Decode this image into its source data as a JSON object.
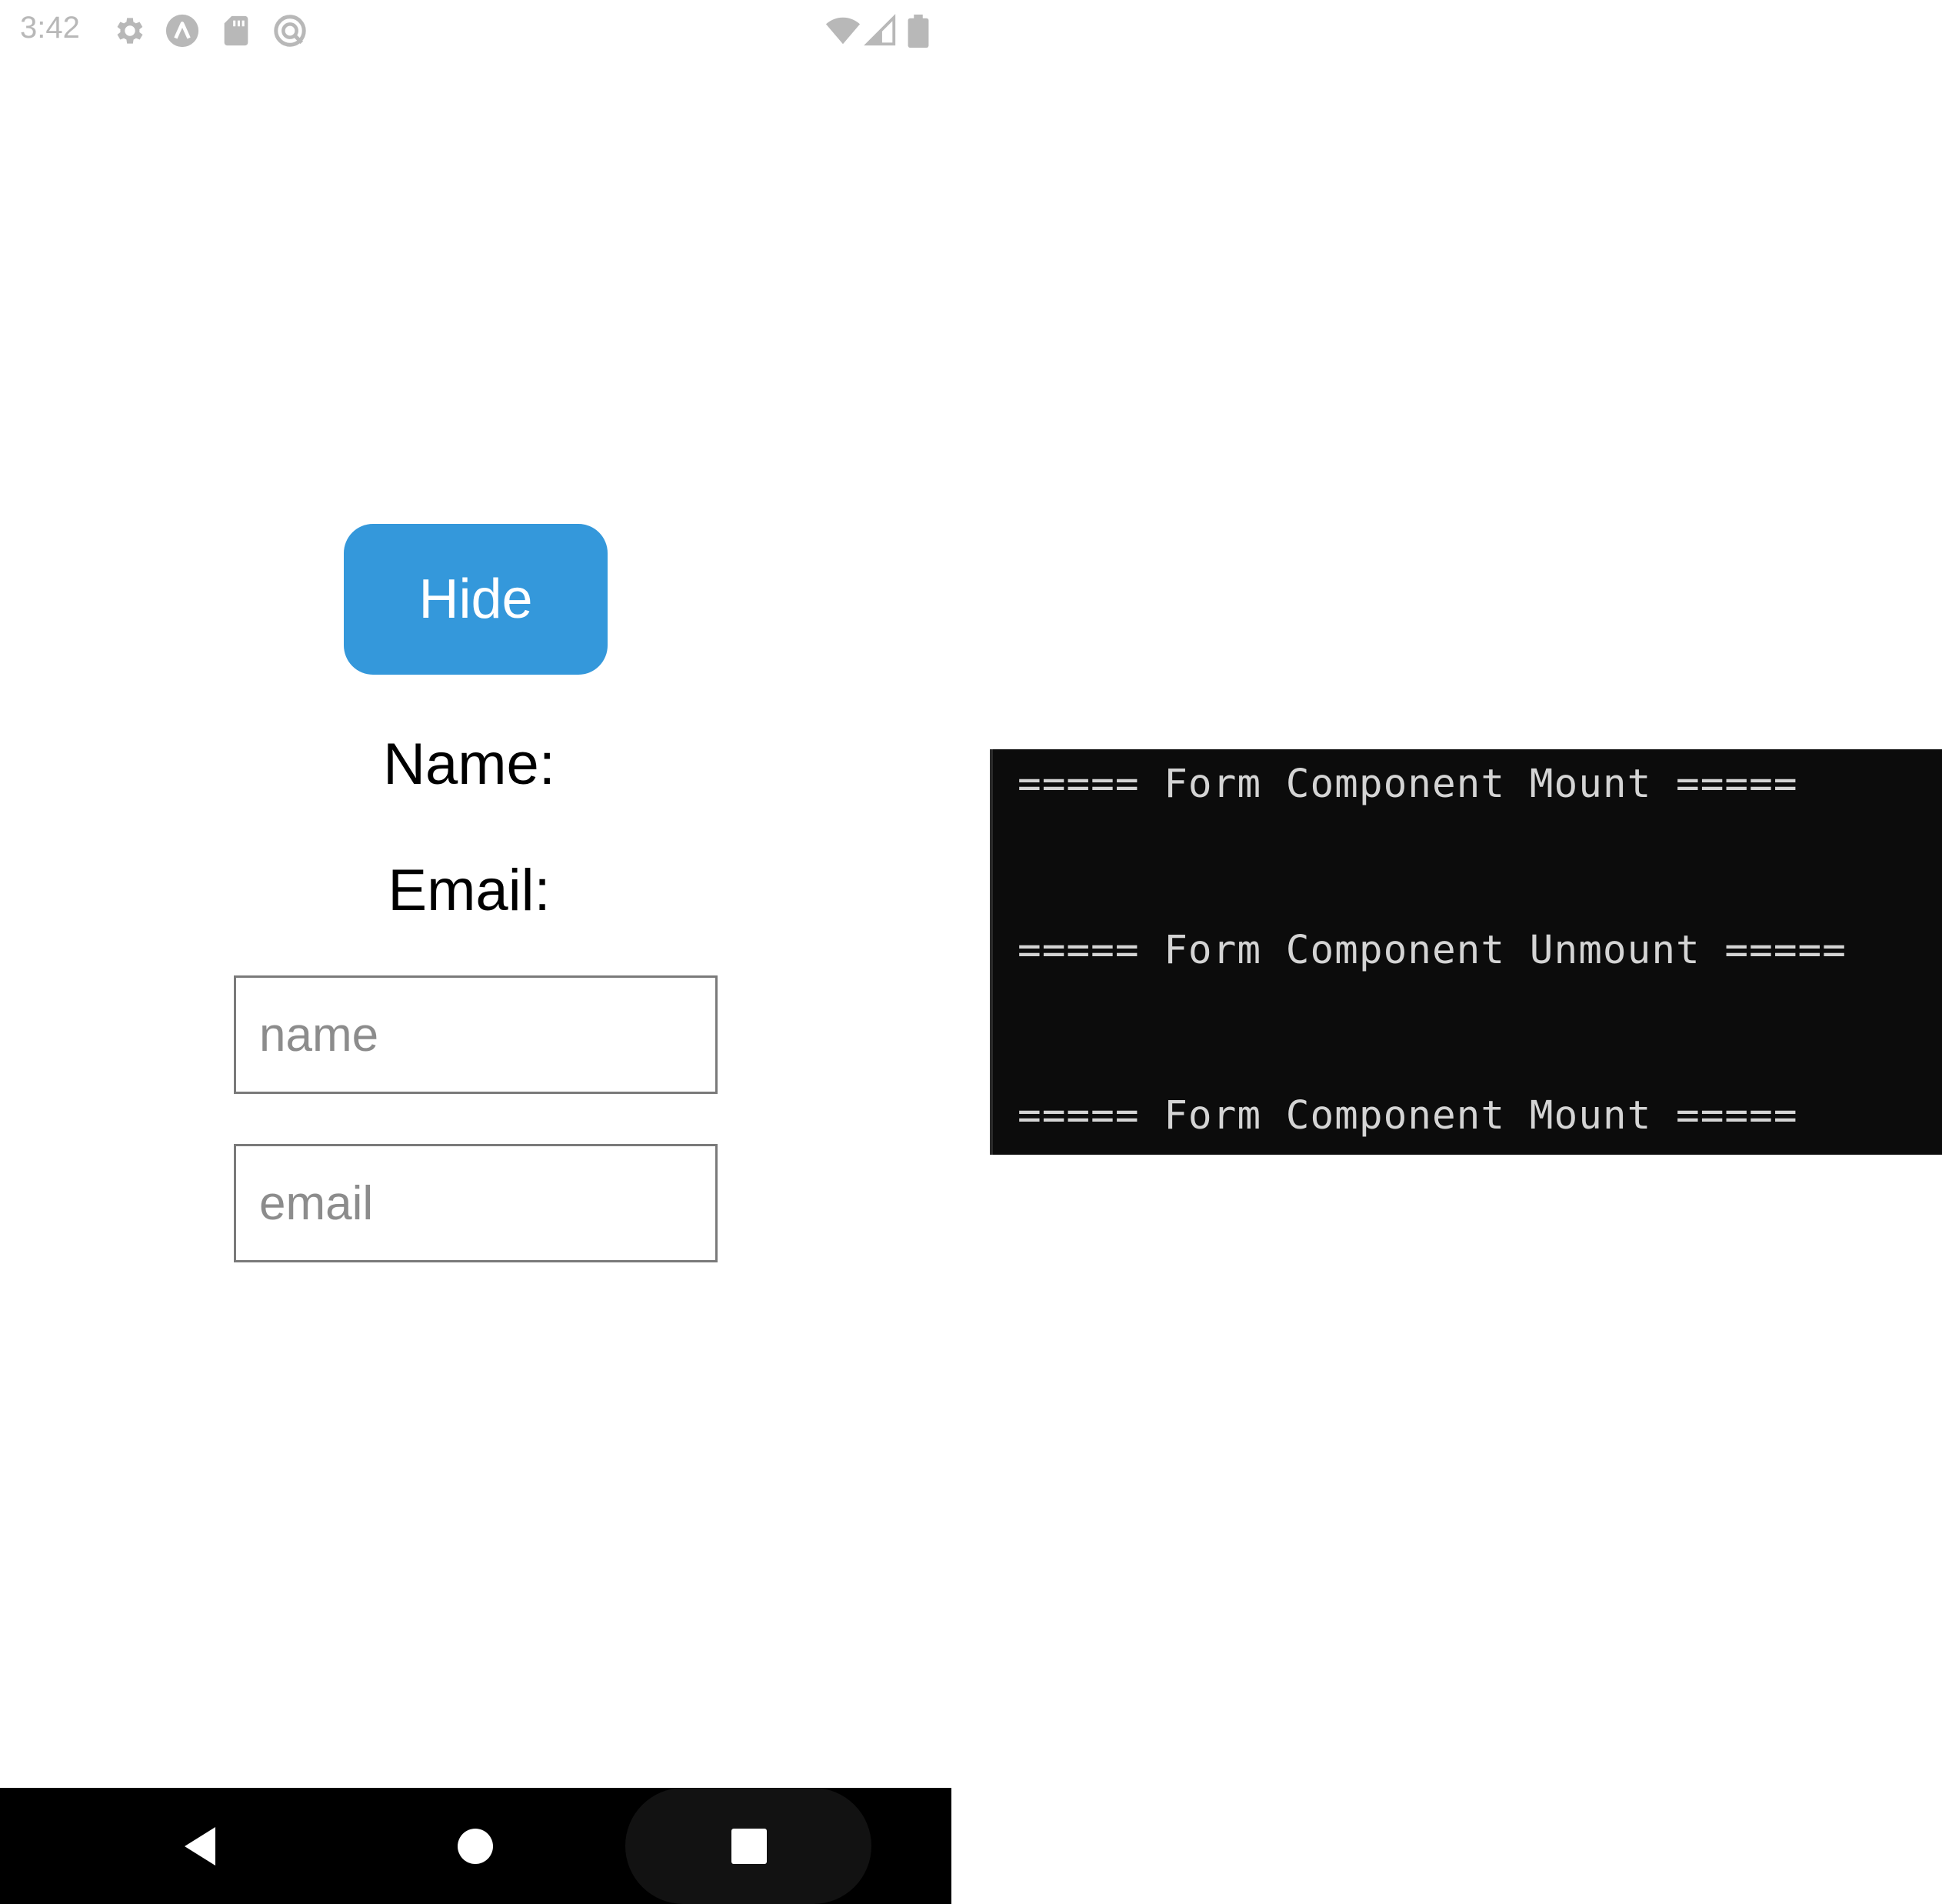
{
  "status_bar": {
    "time": "3:42",
    "left_icons": [
      "gear-icon",
      "react-native-icon",
      "sd-card-icon",
      "sync-icon"
    ],
    "right_icons": [
      "wifi-icon",
      "cellular-signal-icon",
      "battery-icon"
    ],
    "icon_color": "#b8b8b8"
  },
  "app": {
    "hide_button_label": "Hide",
    "hide_button_color": "#3498db",
    "name_label": "Name:",
    "email_label": "Email:",
    "name_input": {
      "value": "",
      "placeholder": "name"
    },
    "email_input": {
      "value": "",
      "placeholder": "email"
    }
  },
  "navigation_bar": {
    "buttons": [
      "back-icon",
      "home-icon",
      "recents-icon"
    ]
  },
  "terminal": {
    "lines": [
      "===== Form Component Mount =====",
      "===== Form Component Unmount =====",
      "===== Form Component Mount ====="
    ]
  }
}
